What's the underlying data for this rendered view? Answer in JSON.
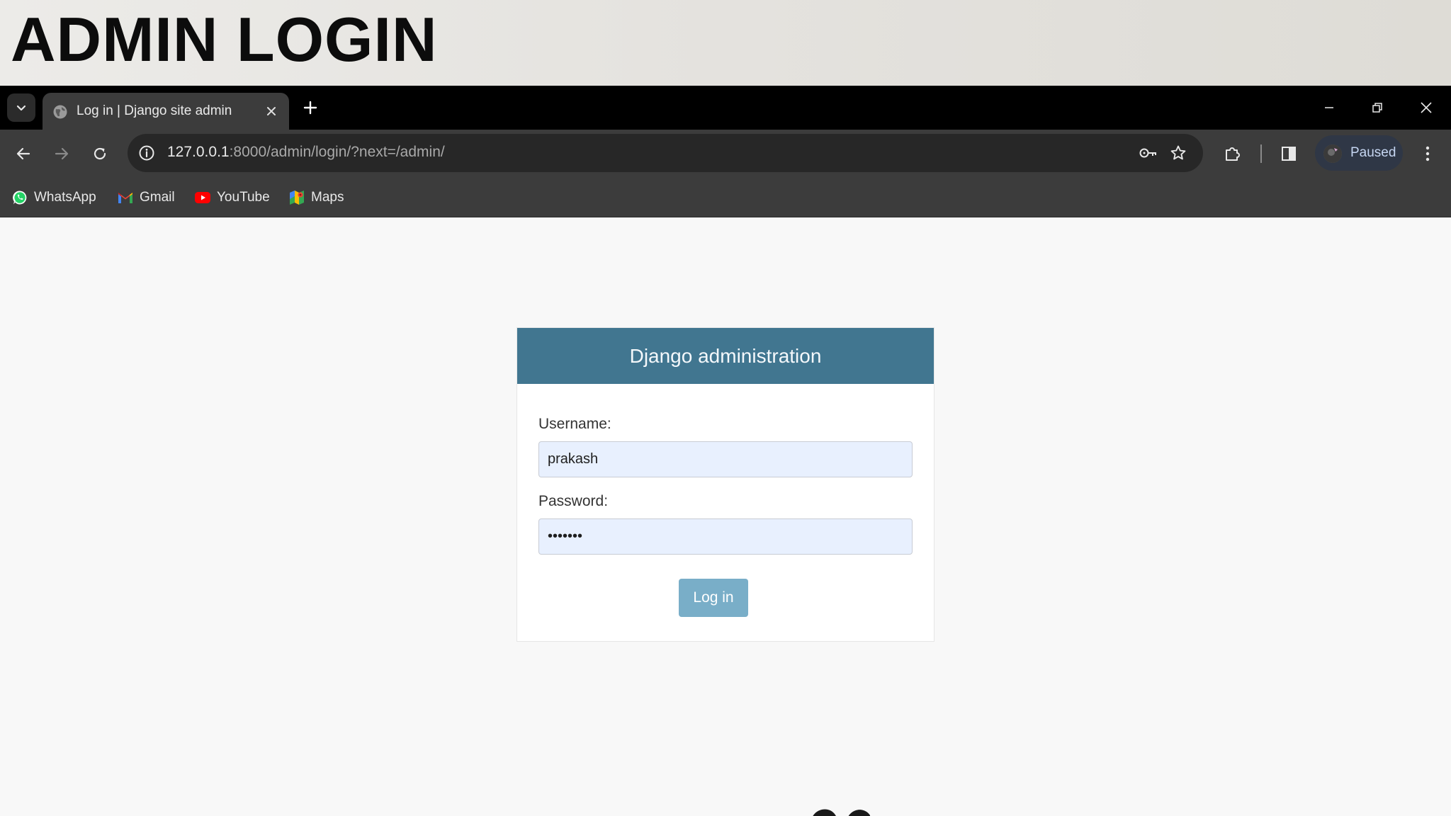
{
  "banner": {
    "title": "ADMIN LOGIN"
  },
  "browser": {
    "tab": {
      "title": "Log in | Django site admin"
    },
    "address": {
      "host": "127.0.0.1",
      "rest": ":8000/admin/login/?next=/admin/"
    },
    "profile": {
      "label": "Paused"
    },
    "bookmarks": [
      {
        "label": "WhatsApp",
        "icon": "whatsapp-icon"
      },
      {
        "label": "Gmail",
        "icon": "gmail-icon"
      },
      {
        "label": "YouTube",
        "icon": "youtube-icon"
      },
      {
        "label": "Maps",
        "icon": "maps-icon"
      }
    ]
  },
  "login": {
    "header": "Django administration",
    "username_label": "Username:",
    "username_value": "prakash",
    "password_label": "Password:",
    "password_value": "•••••••",
    "submit_label": "Log in"
  },
  "colors": {
    "header_bg": "#417690",
    "button_bg": "#79aec8",
    "input_bg": "#e8f0fe",
    "page_bg": "#f8f8f8"
  }
}
